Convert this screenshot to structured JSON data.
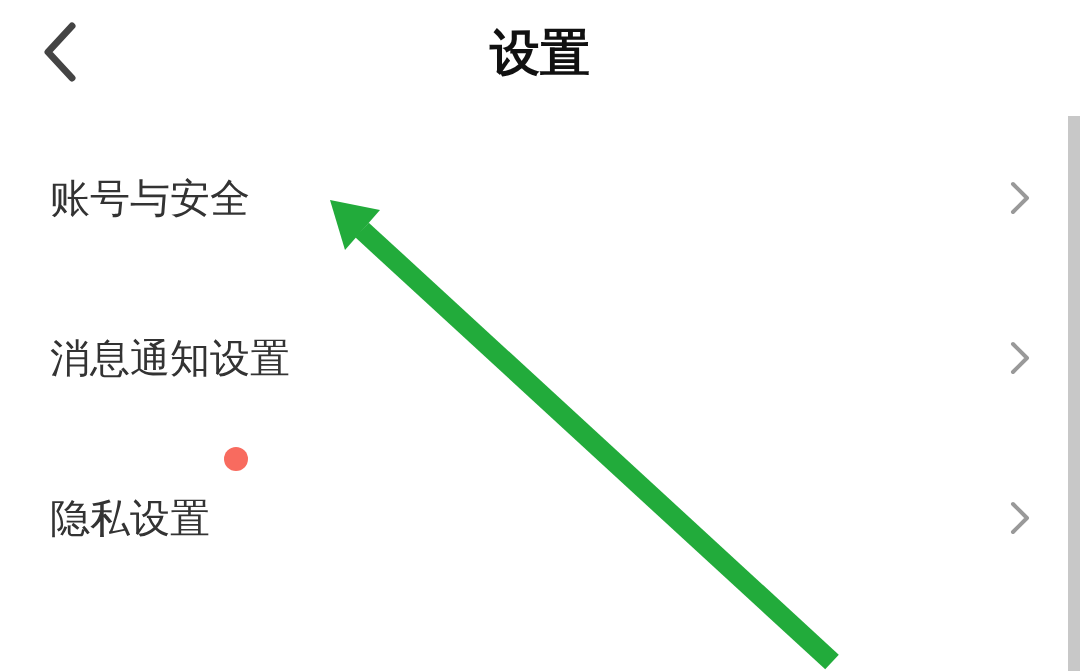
{
  "header": {
    "title": "设置"
  },
  "items": [
    {
      "label": "账号与安全",
      "badge": false
    },
    {
      "label": "消息通知设置",
      "badge": false
    },
    {
      "label": "隐私设置",
      "badge": true
    }
  ],
  "annotation": {
    "kind": "arrow"
  }
}
